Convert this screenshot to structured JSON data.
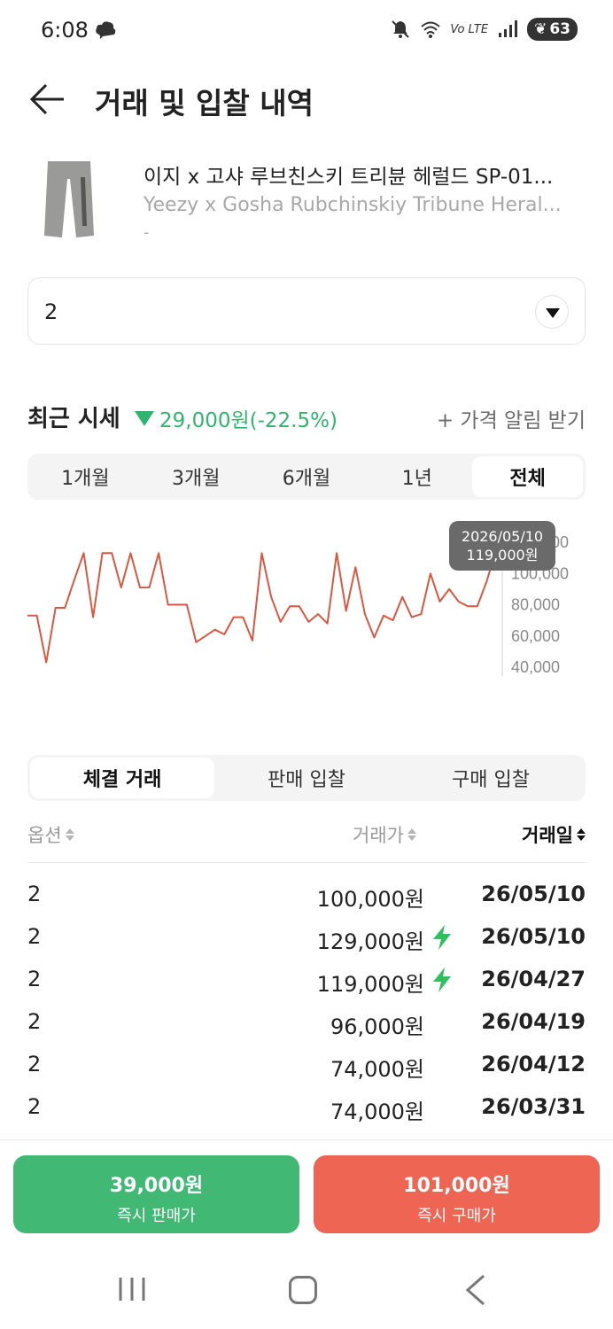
{
  "status_bar": {
    "time": "6:08",
    "lte_label": "Vo LTE",
    "battery": "63"
  },
  "header": {
    "title": "거래 및 입찰 내역"
  },
  "product": {
    "name_ko": "이지 x 고샤 루브친스키 트리뷴 헤럴드 SP-01...",
    "name_en": "Yeezy x Gosha Rubchinskiy Tribune Heral...",
    "dash": "-"
  },
  "size_select": {
    "value": "2"
  },
  "recent": {
    "title": "최근 시세",
    "change": "29,000원(-22.5%)",
    "alert_label": "+ 가격 알림 받기"
  },
  "period_tabs": [
    "1개월",
    "3개월",
    "6개월",
    "1년",
    "전체"
  ],
  "period_active": "전체",
  "chart_data": {
    "type": "line",
    "color": "#d9583f",
    "y_ticks": [
      "120,000",
      "100,000",
      "80,000",
      "60,000",
      "40,000"
    ],
    "ylim": [
      40000,
      120000
    ],
    "tooltip": {
      "date": "2026/05/10",
      "value": "119,000원"
    },
    "values": [
      73000,
      73000,
      43000,
      78000,
      78000,
      96000,
      113000,
      72000,
      113000,
      113000,
      91000,
      113000,
      91000,
      91000,
      113000,
      80000,
      80000,
      80000,
      56000,
      60000,
      64000,
      61000,
      72000,
      72000,
      57000,
      113000,
      85000,
      69000,
      79000,
      79000,
      69000,
      74000,
      68000,
      113000,
      76000,
      104000,
      74000,
      59000,
      73000,
      70000,
      85000,
      72000,
      74000,
      100000,
      82000,
      90000,
      82000,
      79000,
      79000,
      95000,
      115000
    ]
  },
  "trade_tabs": [
    "체결 거래",
    "판매 입찰",
    "구매 입찰"
  ],
  "trade_active": "체결 거래",
  "table": {
    "headers": {
      "option": "옵션",
      "price": "거래가",
      "date": "거래일"
    },
    "rows": [
      {
        "option": "2",
        "price": "100,000원",
        "flash": false,
        "date": "26/05/10"
      },
      {
        "option": "2",
        "price": "129,000원",
        "flash": true,
        "date": "26/05/10"
      },
      {
        "option": "2",
        "price": "119,000원",
        "flash": true,
        "date": "26/04/27"
      },
      {
        "option": "2",
        "price": "96,000원",
        "flash": false,
        "date": "26/04/19"
      },
      {
        "option": "2",
        "price": "74,000원",
        "flash": false,
        "date": "26/04/12"
      },
      {
        "option": "2",
        "price": "74,000원",
        "flash": false,
        "date": "26/03/31"
      }
    ]
  },
  "bottom_bar": {
    "sell_price": "39,000원",
    "sell_label": "즉시 판매가",
    "sell_color": "#41b974",
    "buy_price": "101,000원",
    "buy_label": "즉시 구매가",
    "buy_color": "#ee6553"
  }
}
